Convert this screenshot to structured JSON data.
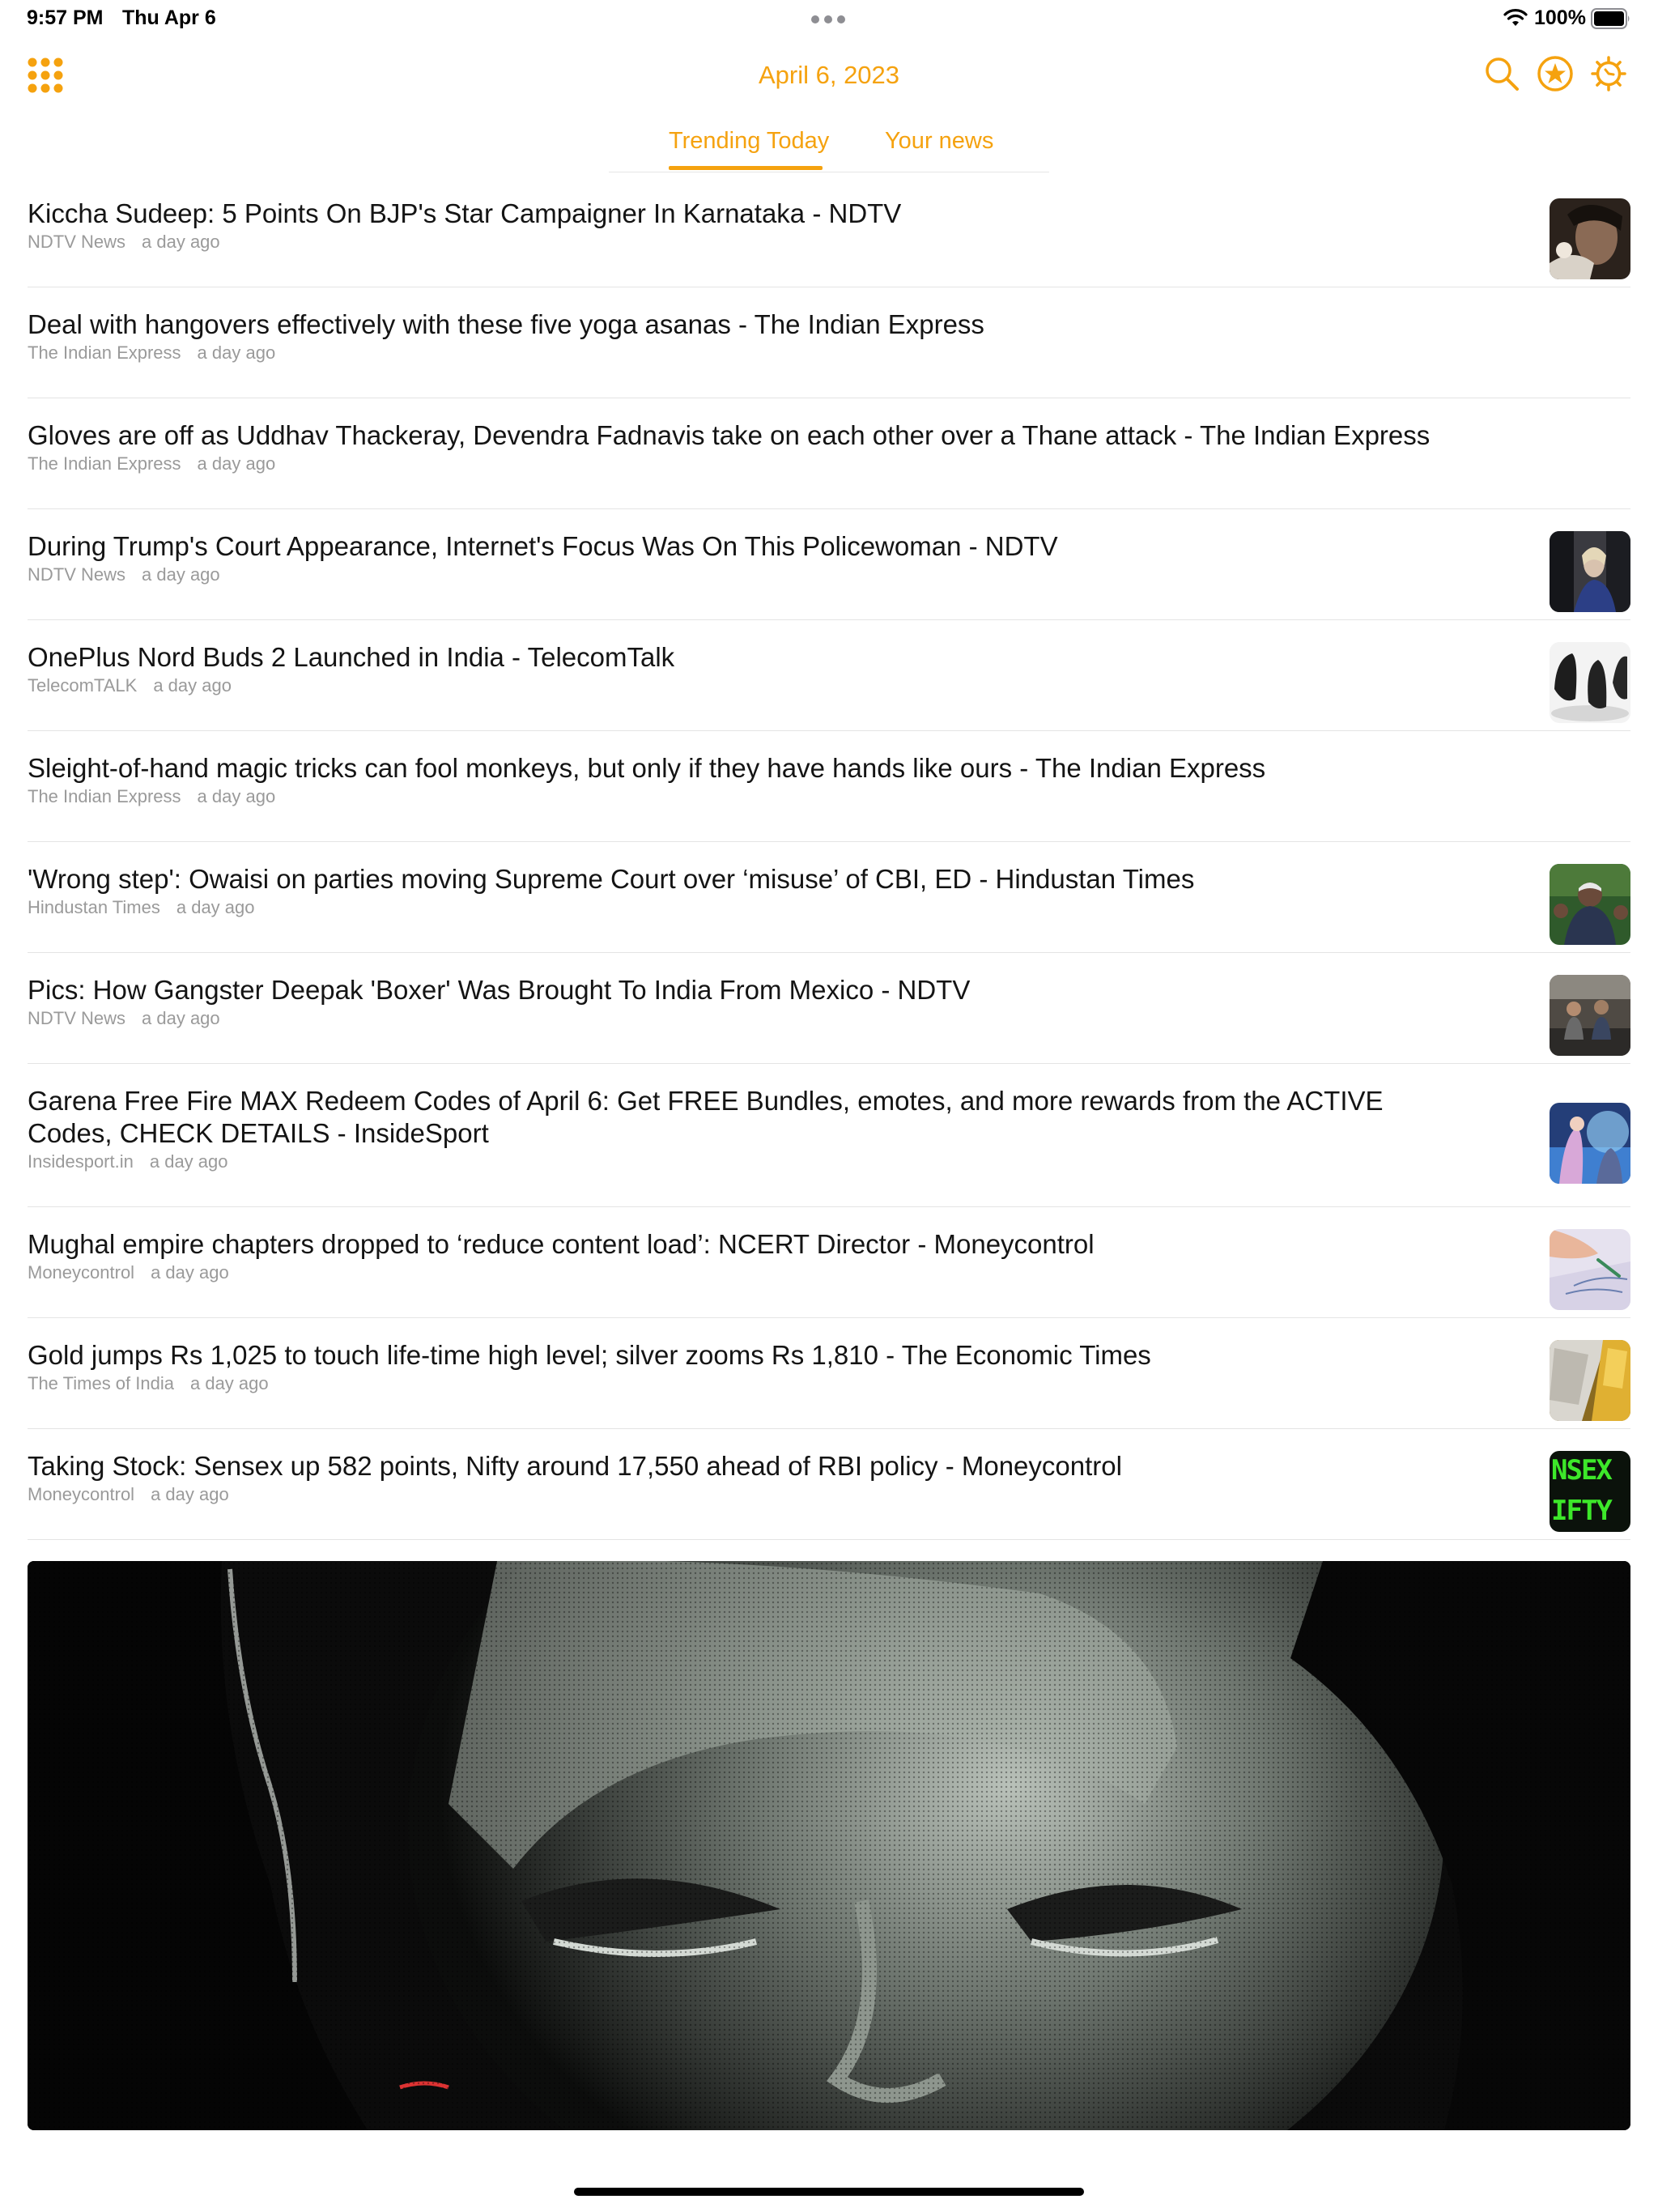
{
  "status_bar": {
    "time": "9:57 PM",
    "date": "Thu Apr 6",
    "battery": "100%"
  },
  "header": {
    "date": "April 6, 2023",
    "icons": [
      "grid-menu-icon",
      "search-icon",
      "star-icon",
      "gear-icon"
    ]
  },
  "tabs": [
    {
      "label": "Trending Today",
      "active": true
    },
    {
      "label": "Your news",
      "active": false
    }
  ],
  "news": [
    {
      "title": "Kiccha Sudeep: 5 Points On BJP's Star Campaigner In Karnataka - NDTV",
      "source": "NDTV News",
      "time": "a day ago"
    },
    {
      "title": "Deal with hangovers effectively with these five yoga asanas - The Indian Express",
      "source": "The Indian Express",
      "time": "a day ago"
    },
    {
      "title": "Gloves are off as Uddhav Thackeray, Devendra Fadnavis take on each other over a Thane attack - The Indian Express",
      "source": "The Indian Express",
      "time": "a day ago"
    },
    {
      "title": "During Trump's Court Appearance, Internet's Focus Was On This Policewoman - NDTV",
      "source": "NDTV News",
      "time": "a day ago"
    },
    {
      "title": "OnePlus Nord Buds 2 Launched in India - TelecomTalk",
      "source": "TelecomTALK",
      "time": "a day ago"
    },
    {
      "title": "Sleight-of-hand magic tricks can fool monkeys, but only if they have hands like ours - The Indian Express",
      "source": "The Indian Express",
      "time": "a day ago"
    },
    {
      "title": "'Wrong step': Owaisi on parties moving Supreme Court over ‘misuse’ of CBI, ED - Hindustan Times",
      "source": "Hindustan Times",
      "time": "a day ago"
    },
    {
      "title": "Pics: How Gangster Deepak 'Boxer' Was Brought To India From Mexico - NDTV",
      "source": "NDTV News",
      "time": "a day ago"
    },
    {
      "title": "Garena Free Fire MAX Redeem Codes of April 6: Get FREE Bundles, emotes, and more rewards from the ACTIVE Codes, CHECK DETAILS - InsideSport",
      "source": "Insidesport.in",
      "time": "a day ago"
    },
    {
      "title": "Mughal empire chapters dropped to ‘reduce content load’: NCERT Director - Moneycontrol",
      "source": "Moneycontrol",
      "time": "a day ago"
    },
    {
      "title": "Gold jumps Rs 1,025 to touch life-time high level; silver zooms Rs 1,810 - The Economic Times",
      "source": "The Times of India",
      "time": "a day ago"
    },
    {
      "title": "Taking Stock: Sensex up 582 points, Nifty around 17,550 ahead of RBI policy - Moneycontrol",
      "source": "Moneycontrol",
      "time": "a day ago",
      "thumb_text": [
        "NSEX",
        "IFTY"
      ]
    }
  ],
  "colors": {
    "accent": "#f5a20f",
    "meta": "#9a9a9a",
    "divider": "#e4e4e4"
  }
}
